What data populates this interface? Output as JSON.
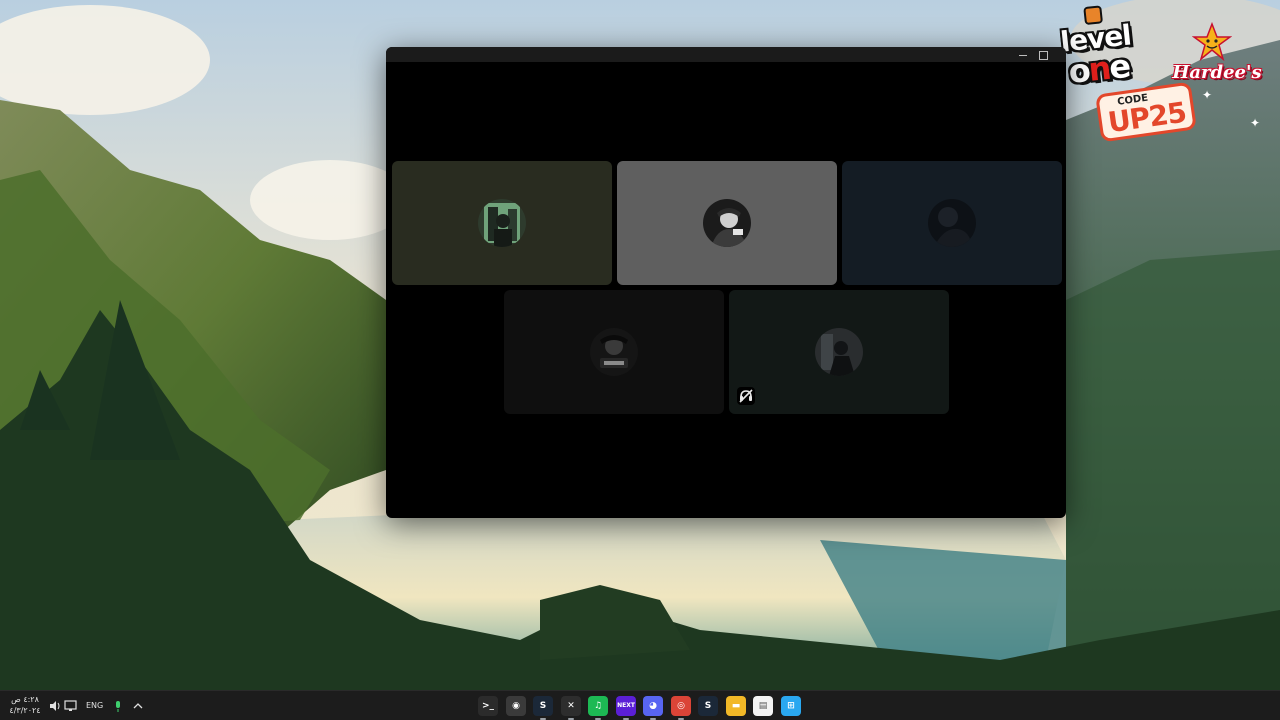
{
  "promo": {
    "brand_line1": "level",
    "brand_line2a": "o",
    "brand_line2b": "n",
    "brand_line2c": "e",
    "partner": "Hardee's",
    "code_label": "CODE",
    "code_value": "UP25",
    "colors": {
      "red": "#e3472b",
      "star": "#f6b21a"
    }
  },
  "call_window": {
    "background": "#000000",
    "title_bar_buttons": [
      "minimize-icon",
      "maximize-icon"
    ],
    "participants": [
      {
        "tile_color": "#292c20",
        "avatar": "avatar-green-photo"
      },
      {
        "tile_color": "#5f5f5f",
        "avatar": "avatar-bw-photo",
        "speaking": true
      },
      {
        "tile_color": "#141c24",
        "avatar": "avatar-dark-photo"
      },
      {
        "tile_color": "#0f0f0f",
        "avatar": "avatar-logo-photo"
      },
      {
        "tile_color": "#121816",
        "avatar": "avatar-grey-photo",
        "status_icon": "deafened-icon"
      }
    ]
  },
  "taskbar": {
    "clock_time": "٤:٢٨ ص",
    "clock_date": "٤/٣/٢٠٢٤",
    "language": "ENG",
    "tray_icons": [
      "volume-icon",
      "network-icon",
      "microphone-icon",
      "chevron-up-icon"
    ],
    "apps": [
      {
        "name": "terminal-icon",
        "glyph": ">_",
        "color": "#2b2b2b"
      },
      {
        "name": "obs-icon",
        "glyph": "◉",
        "color": "#3a3a3a"
      },
      {
        "name": "steam-icon",
        "glyph": "S",
        "color": "#1b2838"
      },
      {
        "name": "xbox-icon",
        "glyph": "✕",
        "color": "#2d2d2d"
      },
      {
        "name": "spotify-icon",
        "glyph": "♫",
        "color": "#1db954"
      },
      {
        "name": "next-icon",
        "glyph": "NEXT",
        "color": "#5b1fd6"
      },
      {
        "name": "discord-icon",
        "glyph": "◕",
        "color": "#5865f2"
      },
      {
        "name": "chrome-icon",
        "glyph": "◎",
        "color": "#db4437"
      },
      {
        "name": "steam-alt-icon",
        "glyph": "S",
        "color": "#1b2838"
      },
      {
        "name": "file-explorer-icon",
        "glyph": "▬",
        "color": "#f2b827"
      },
      {
        "name": "notepad-icon",
        "glyph": "▤",
        "color": "#f4f4f4"
      },
      {
        "name": "start-icon",
        "glyph": "⊞",
        "color": "#2aa8f0"
      }
    ]
  }
}
